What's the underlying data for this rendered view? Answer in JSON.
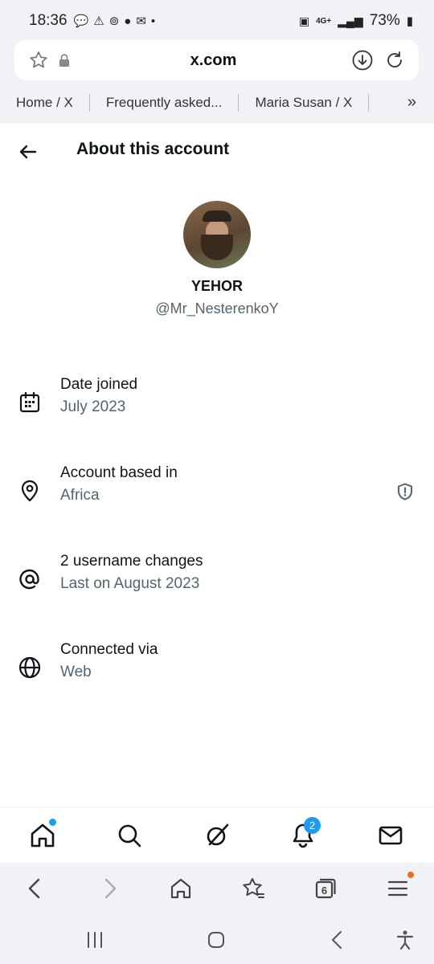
{
  "status": {
    "time": "18:36",
    "network": "4G+",
    "battery": "73%"
  },
  "browser": {
    "url": "x.com",
    "quick_tabs": [
      "Home / X",
      "Frequently asked...",
      "Maria Susan / X"
    ],
    "tab_count": "6"
  },
  "page": {
    "title": "About this account",
    "profile": {
      "name": "YEHOR",
      "handle": "@Mr_NesterenkoY"
    },
    "rows": [
      {
        "label": "Date joined",
        "value": "July 2023"
      },
      {
        "label": "Account based in",
        "value": "Africa"
      },
      {
        "label": "2 username changes",
        "value": "Last on August 2023"
      },
      {
        "label": "Connected via",
        "value": "Web"
      }
    ]
  },
  "nav": {
    "notifications_badge": "2"
  }
}
